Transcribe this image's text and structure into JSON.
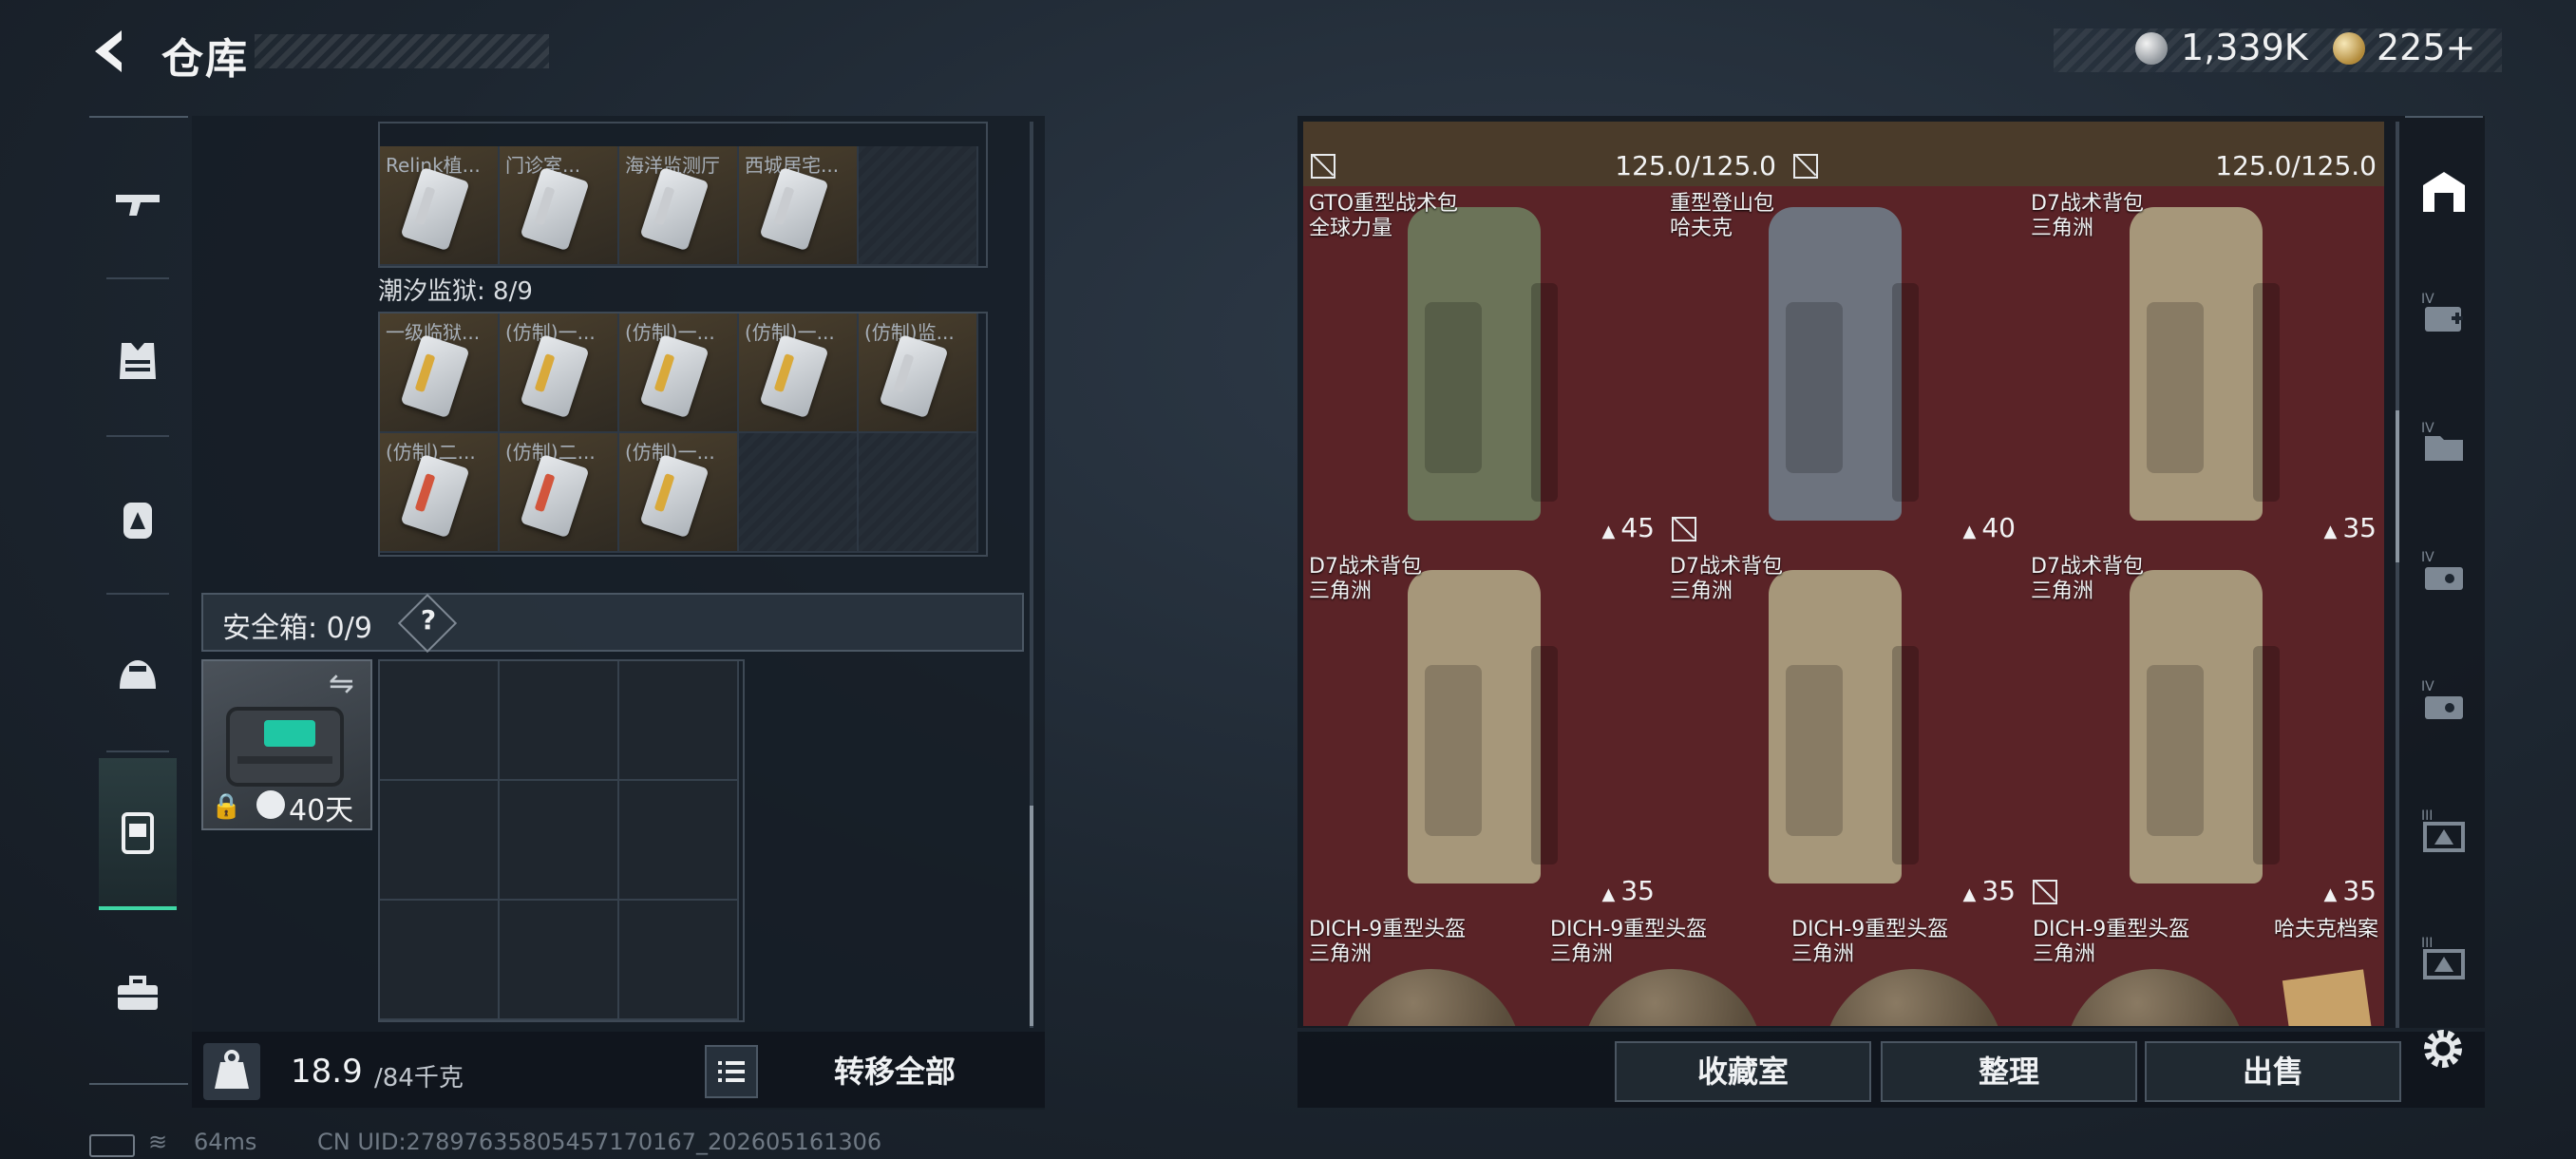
{
  "header": {
    "title": "仓库"
  },
  "currency": {
    "silver": "1,339K",
    "gold": "225+"
  },
  "sidebar": {
    "items": [
      {
        "name": "weapons",
        "icon": "rifle-icon"
      },
      {
        "name": "armor",
        "icon": "vest-icon"
      },
      {
        "name": "backpack",
        "icon": "backpack-icon"
      },
      {
        "name": "helmet",
        "icon": "helmet-icon"
      },
      {
        "name": "storage",
        "icon": "container-icon",
        "active": true
      },
      {
        "name": "toolbox",
        "icon": "toolbox-icon"
      }
    ]
  },
  "inventory": {
    "row1_labels": [
      "Relink植...",
      "门诊室...",
      "海洋监测厅",
      "西城居宅..."
    ],
    "section": {
      "name": "潮汐监狱",
      "count": "8/9",
      "label": "潮汐监狱: 8/9"
    },
    "row2_labels": [
      "一级临狱...",
      "(仿制)一...",
      "(仿制)一...",
      "(仿制)一...",
      "(仿制)监..."
    ],
    "row3_labels": [
      "(仿制)二...",
      "(仿制)二...",
      "(仿制)一..."
    ],
    "safe_box": {
      "label": "安全箱: 0/9",
      "help": "?",
      "time": "40天"
    },
    "weight": {
      "current": "18.9",
      "max": "/84千克"
    },
    "transfer_all": "转移全部"
  },
  "vault": {
    "top_strip": [
      {
        "capacity": "125.0/125.0"
      },
      {
        "capacity": "125.0/125.0"
      }
    ],
    "items": [
      {
        "name": "GTO重型战术包",
        "source": "全球力量",
        "capacity": "45",
        "color": "#6b7358"
      },
      {
        "name": "重型登山包",
        "source": "哈夫克",
        "capacity": "40",
        "color": "#6d737e"
      },
      {
        "name": "D7战术背包",
        "source": "三角洲",
        "capacity": "35",
        "color": "#a6977a"
      },
      {
        "name": "D7战术背包",
        "source": "三角洲",
        "capacity": "35",
        "color": "#a6977a"
      },
      {
        "name": "D7战术背包",
        "source": "三角洲",
        "capacity": "35",
        "color": "#a6977a"
      },
      {
        "name": "D7战术背包",
        "source": "三角洲",
        "capacity": "35",
        "color": "#a6977a"
      }
    ],
    "helmets": [
      {
        "name": "DICH-9重型头盔",
        "source": "三角洲"
      },
      {
        "name": "DICH-9重型头盔",
        "source": "三角洲"
      },
      {
        "name": "DICH-9重型头盔",
        "source": "三角洲"
      },
      {
        "name": "DICH-9重型头盔",
        "source": "三角洲"
      }
    ],
    "dossier": {
      "name": "哈夫克档案"
    }
  },
  "footer_buttons": {
    "collection": "收藏室",
    "sort": "整理",
    "sell": "出售"
  },
  "status": {
    "ping": "64ms",
    "uid": "CN UID:27897635805457170167_202605161306"
  },
  "colors": {
    "accent": "#3fd7a5",
    "vault_bg": "#5a2327"
  }
}
